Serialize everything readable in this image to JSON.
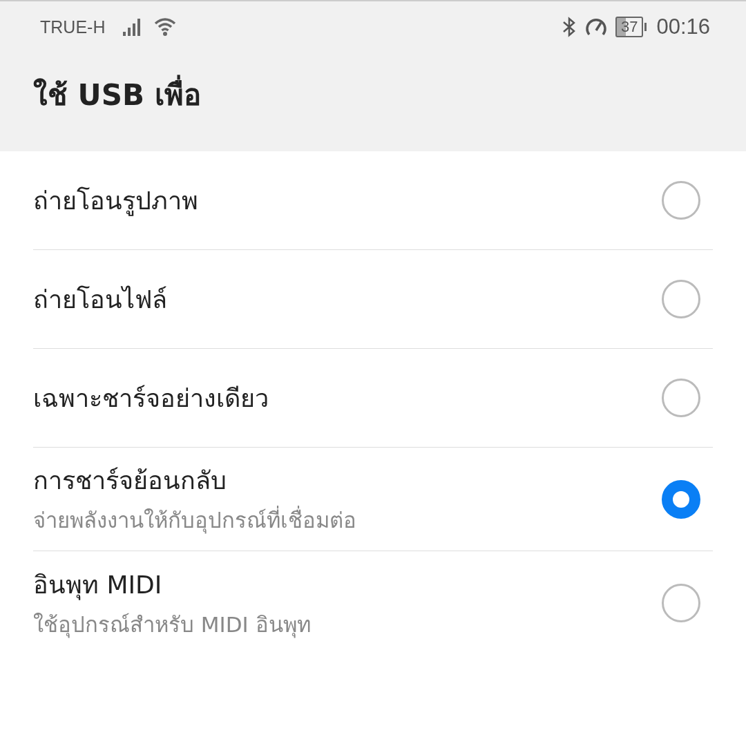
{
  "status_bar": {
    "carrier": "TRUE-H",
    "battery": "37",
    "time": "00:16"
  },
  "title": "ใช้ USB เพื่อ",
  "options": [
    {
      "label": "ถ่ายโอนรูปภาพ",
      "selected": false
    },
    {
      "label": "ถ่ายโอนไฟล์",
      "selected": false
    },
    {
      "label": "เฉพาะชาร์จอย่างเดียว",
      "selected": false
    },
    {
      "label": "การชาร์จย้อนกลับ",
      "description": "จ่ายพลังงานให้กับอุปกรณ์ที่เชื่อมต่อ",
      "selected": true
    },
    {
      "label": "อินพุท MIDI",
      "description": "ใช้อุปกรณ์สำหรับ MIDI อินพุท",
      "selected": false
    }
  ]
}
